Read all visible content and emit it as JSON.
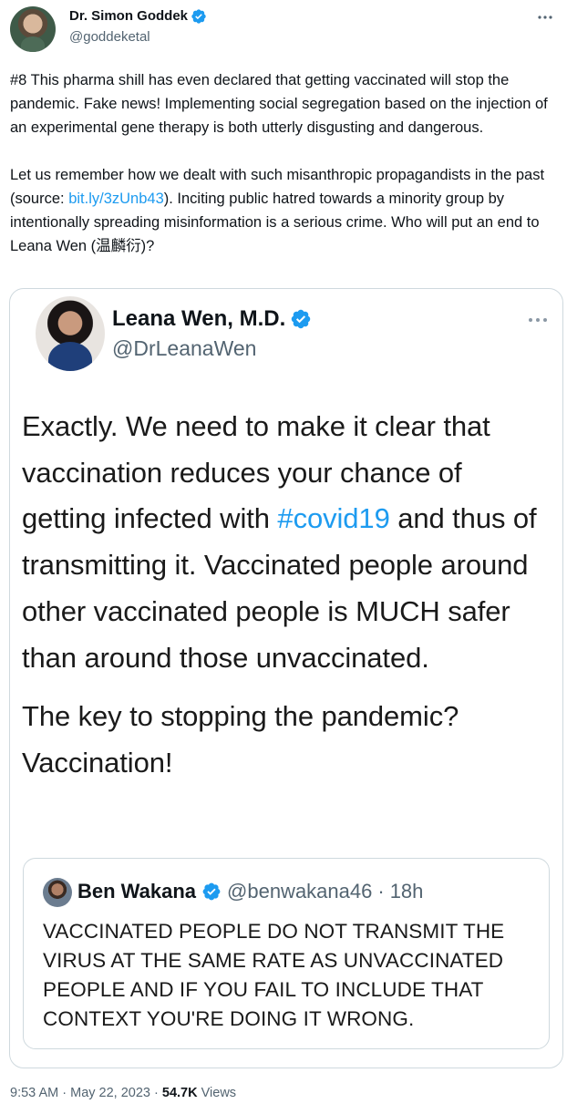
{
  "author": {
    "name": "Dr. Simon Goddek",
    "handle": "@goddeketal",
    "verified_icon": "verified-badge-icon"
  },
  "tweet": {
    "paragraph_1": "#8 This pharma shill has even declared that getting vaccinated will stop the pandemic. Fake news! Implementing social segregation based on the injection of an experimental gene therapy is both utterly disgusting and dangerous.",
    "paragraph_2_before_link": "Let us remember how we dealt with such misanthropic propagandists in the past (source: ",
    "link_text": "bit.ly/3zUnb43",
    "paragraph_2_after_link": "). Inciting public hatred towards a minority group by intentionally spreading misinformation is a serious crime. Who will put an end to Leana Wen (温麟衍)?"
  },
  "embedded": {
    "name": "Leana Wen, M.D.",
    "handle": "@DrLeanaWen",
    "body_1_before_hashtag": "Exactly. We need to make it clear that vaccination reduces your chance of getting infected with ",
    "hashtag": "#covid19",
    "body_1_after_hashtag": " and thus of transmitting it. Vaccinated people around other vaccinated people is MUCH safer than around those unvaccinated.",
    "body_2": "The key to stopping the pandemic? Vaccination!",
    "quote": {
      "name": "Ben Wakana",
      "handle": "@benwakana46",
      "separator": "·",
      "time": "18h",
      "text": "VACCINATED PEOPLE DO NOT TRANSMIT THE VIRUS AT THE SAME RATE AS UNVACCINATED PEOPLE AND IF YOU FAIL TO INCLUDE THAT CONTEXT YOU'RE DOING IT WRONG."
    }
  },
  "meta": {
    "time": "9:53 AM",
    "separator": "·",
    "date": "May 22, 2023",
    "views_count": "54.7K",
    "views_label": "Views"
  },
  "colors": {
    "link": "#1d9bf0",
    "verified": "#1d9bf0",
    "secondary_text": "#536471",
    "border": "#cfd9de"
  }
}
